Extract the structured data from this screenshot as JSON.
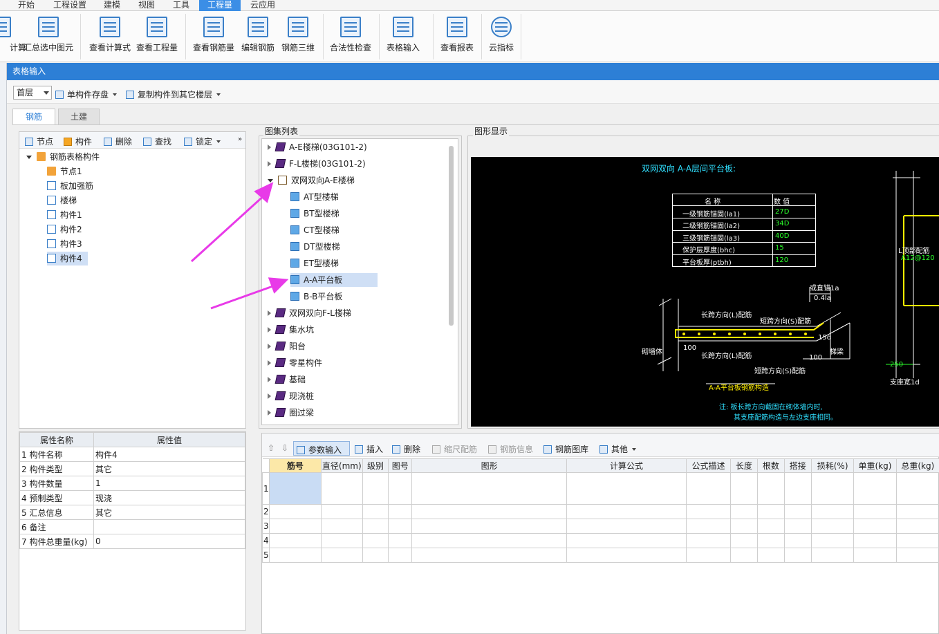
{
  "menu": [
    "开始",
    "工程设置",
    "建模",
    "视图",
    "工具",
    "工程量",
    "云应用"
  ],
  "menu_active_index": 5,
  "ribbon": [
    "计算",
    "汇总选中图元",
    "查看计算式",
    "查看工程量",
    "查看钢筋量",
    "编辑钢筋",
    "钢筋三维",
    "合法性检查",
    "表格输入",
    "查看报表",
    "云指标"
  ],
  "window_title": "表格输入",
  "toolbar": {
    "floor": "首层",
    "save_single": "单构件存盘",
    "copy_to_floor": "复制构件到其它楼层"
  },
  "tabs": [
    "钢筋",
    "土建"
  ],
  "left_toolbar": [
    "节点",
    "构件",
    "删除",
    "查找",
    "锁定"
  ],
  "component_tree": {
    "root": "钢筋表格构件",
    "children": [
      "节点1",
      "板加强筋",
      "楼梯",
      "构件1",
      "构件2",
      "构件3",
      "构件4"
    ],
    "selected": "构件4"
  },
  "properties": {
    "headers": [
      "属性名称",
      "属性值"
    ],
    "rows": [
      {
        "n": "1",
        "name": "构件名称",
        "value": "构件4"
      },
      {
        "n": "2",
        "name": "构件类型",
        "value": "其它"
      },
      {
        "n": "3",
        "name": "构件数量",
        "value": "1"
      },
      {
        "n": "4",
        "name": "预制类型",
        "value": "现浇"
      },
      {
        "n": "5",
        "name": "汇总信息",
        "value": "其它"
      },
      {
        "n": "6",
        "name": "备注",
        "value": ""
      },
      {
        "n": "7",
        "name": "构件总重量(kg)",
        "value": "0"
      }
    ]
  },
  "atlas": {
    "title": "图集列表",
    "items": [
      {
        "label": "A-E楼梯(03G101-2)",
        "level": 0,
        "icon": "book-icon",
        "state": "collapsed"
      },
      {
        "label": "F-L楼梯(03G101-2)",
        "level": 0,
        "icon": "book-icon",
        "state": "collapsed"
      },
      {
        "label": "双网双向A-E楼梯",
        "level": 0,
        "icon": "open-book-icon",
        "state": "expanded"
      },
      {
        "label": "AT型楼梯",
        "level": 1,
        "icon": "page-icon",
        "state": "leaf"
      },
      {
        "label": "BT型楼梯",
        "level": 1,
        "icon": "page-icon",
        "state": "leaf"
      },
      {
        "label": "CT型楼梯",
        "level": 1,
        "icon": "page-icon",
        "state": "leaf"
      },
      {
        "label": "DT型楼梯",
        "level": 1,
        "icon": "page-icon",
        "state": "leaf"
      },
      {
        "label": "ET型楼梯",
        "level": 1,
        "icon": "page-icon",
        "state": "leaf"
      },
      {
        "label": "A-A平台板",
        "level": 1,
        "icon": "page-icon",
        "state": "selected"
      },
      {
        "label": "B-B平台板",
        "level": 1,
        "icon": "page-icon",
        "state": "leaf"
      },
      {
        "label": "双网双向F-L楼梯",
        "level": 0,
        "icon": "book-icon",
        "state": "collapsed"
      },
      {
        "label": "集水坑",
        "level": 0,
        "icon": "book-icon",
        "state": "collapsed"
      },
      {
        "label": "阳台",
        "level": 0,
        "icon": "book-icon",
        "state": "collapsed"
      },
      {
        "label": "零星构件",
        "level": 0,
        "icon": "book-icon",
        "state": "collapsed"
      },
      {
        "label": "基础",
        "level": 0,
        "icon": "book-icon",
        "state": "collapsed"
      },
      {
        "label": "现浇桩",
        "level": 0,
        "icon": "book-icon",
        "state": "collapsed"
      },
      {
        "label": "圈过梁",
        "level": 0,
        "icon": "book-icon",
        "state": "collapsed"
      }
    ]
  },
  "figure": {
    "title": "图形显示",
    "drawing_title": "双网双向 A-A层间平台板:",
    "table_headers": [
      "名 称",
      "数 值"
    ],
    "table_rows": [
      {
        "name": "一级钢筋锚固(la1)",
        "value": "27D"
      },
      {
        "name": "二级钢筋锚固(la2)",
        "value": "34D"
      },
      {
        "name": "三级钢筋锚固(la3)",
        "value": "40D"
      },
      {
        "name": "保护层厚度(bhc)",
        "value": "15"
      },
      {
        "name": "平台板厚(ptbh)",
        "value": "120"
      }
    ],
    "labels": {
      "anchor": "或直锚1a",
      "ratio": "0.4la",
      "long_top": "长跨方向(L)配筋",
      "short_top": "短跨方向(S)配筋",
      "d15": "15d",
      "wall": "砌墙体",
      "w100": "100",
      "long_bottom": "长跨方向(L)配筋",
      "h100": "100",
      "beam": "梯梁",
      "short_bottom": "短跨方向(S)配筋",
      "caption": "A-A平台板钢筋构造",
      "note1": "注: 板长跨方向截固在砌体墙内时,",
      "note2": "其支座配筋构造与左边支座相同。",
      "right_top": "L顶部配筋",
      "right_code": "A12@120",
      "right_250": "250",
      "right_support": "支座宽1d"
    }
  },
  "bottom_toolbar": [
    "参数输入",
    "插入",
    "删除",
    "缩尺配筋",
    "钢筋信息",
    "钢筋图库",
    "其他"
  ],
  "grid": {
    "headers": [
      "筋号",
      "直径(mm)",
      "级别",
      "图号",
      "图形",
      "计算公式",
      "公式描述",
      "长度",
      "根数",
      "搭接",
      "损耗(%)",
      "单重(kg)",
      "总重(kg)"
    ],
    "row_numbers": [
      "1",
      "2",
      "3",
      "4",
      "5"
    ]
  },
  "colors": {
    "accent": "#2d7fd6",
    "selection": "#cfdff5",
    "arrow": "#e83ae8",
    "drawing_yellow": "#ffee00",
    "drawing_green": "#2bff2b",
    "drawing_cyan": "#30e0ff"
  }
}
